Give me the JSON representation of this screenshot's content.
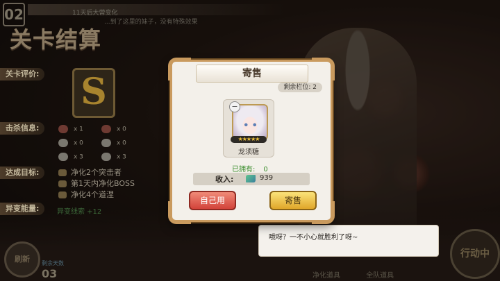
{
  "background": {
    "level_number": "02",
    "top_strip_text": "11天后大营变化",
    "top_strip_text2": "...到了这里的妹子，没有特殊效果",
    "settle_title": "关卡结算",
    "rating_label": "关卡评价:",
    "rating_grade": "S",
    "kill_label": "击杀信息:",
    "kills": [
      {
        "icon": "red-demon-icon",
        "count": "x 1"
      },
      {
        "icon": "red-demon-icon",
        "count": "x 0"
      },
      {
        "icon": "white-blob-icon",
        "count": "x 0"
      },
      {
        "icon": "white-blob-icon",
        "count": "x 0"
      },
      {
        "icon": "white-blob-icon",
        "count": "x 3"
      },
      {
        "icon": "white-blob-icon",
        "count": "x 3"
      }
    ],
    "goal_label": "达成目标:",
    "goals": [
      "净化2个突击者",
      "第1天内净化BOSS",
      "净化4个道涅"
    ],
    "energy_label": "异变能量:",
    "energy_value": "异变线索 +12",
    "bottom_left_button": "刷新",
    "day_label": "剩余天数",
    "day_value": "03",
    "bottom_buttons": [
      "净化道具",
      "全队道具"
    ],
    "action_button": "行动中"
  },
  "dialogue": {
    "text": "哦呀？一不小心就胜利了呀~"
  },
  "modal": {
    "title": "寄售",
    "slots_label": "剩余栏位: 2",
    "item_name": "龙须糖",
    "stars": "★★★★★",
    "owned_label": "已拥有:",
    "owned_value": "0",
    "income_label": "收入:",
    "income_value": "939",
    "self_use_button": "自己用",
    "sell_button": "寄售"
  }
}
